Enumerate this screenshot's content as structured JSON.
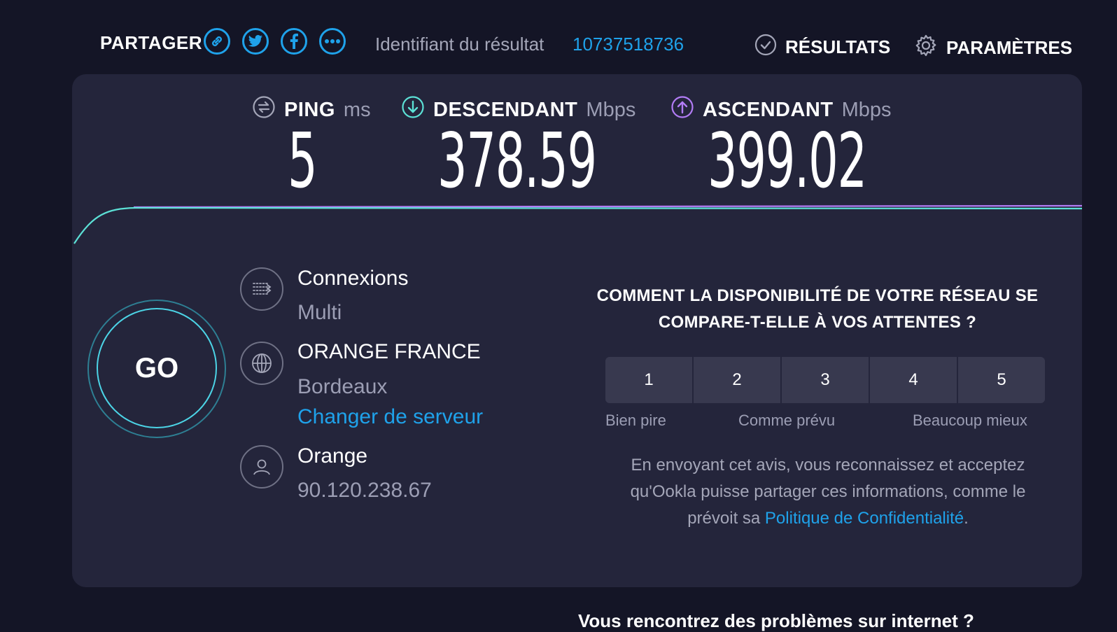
{
  "header": {
    "share_label": "PARTAGER",
    "share_icons": [
      "link-icon",
      "twitter-icon",
      "facebook-icon",
      "more-icon"
    ],
    "result_id_label": "Identifiant du résultat",
    "result_id_value": "10737518736",
    "results_label": "RÉSULTATS",
    "settings_label": "PARAMÈTRES"
  },
  "metrics": {
    "ping": {
      "name": "PING",
      "unit": "ms",
      "value": "5",
      "icon": "ping-icon",
      "color": "#a4a6b8"
    },
    "download": {
      "name": "DESCENDANT",
      "unit": "Mbps",
      "value": "378.59",
      "icon": "download-icon",
      "color": "#5ce1d6"
    },
    "upload": {
      "name": "ASCENDANT",
      "unit": "Mbps",
      "value": "399.02",
      "icon": "upload-icon",
      "color": "#b27cf5"
    }
  },
  "go_button": {
    "label": "GO"
  },
  "info": {
    "connections": {
      "title": "Connexions",
      "value": "Multi"
    },
    "server": {
      "title": "ORANGE FRANCE",
      "location": "Bordeaux",
      "change_link": "Changer de serveur"
    },
    "isp": {
      "title": "Orange",
      "ip": "90.120.238.67"
    }
  },
  "survey": {
    "question": "COMMENT LA DISPONIBILITÉ DE VOTRE RÉSEAU SE COMPARE-T-ELLE À VOS ATTENTES ?",
    "ratings": [
      "1",
      "2",
      "3",
      "4",
      "5"
    ],
    "label_low": "Bien pire",
    "label_mid": "Comme prévu",
    "label_high": "Beaucoup mieux",
    "disclaimer_text": "En envoyant cet avis, vous reconnaissez et acceptez qu'Ookla puisse partager ces informations, comme le prévoit sa ",
    "disclaimer_link": "Politique de Confidentialité",
    "disclaimer_end": "."
  },
  "footer": {
    "heading": "Vous rencontrez des problèmes sur internet ?"
  },
  "colors": {
    "accent": "#1fa2ea",
    "card_bg": "#24253b",
    "page_bg": "#141526"
  }
}
